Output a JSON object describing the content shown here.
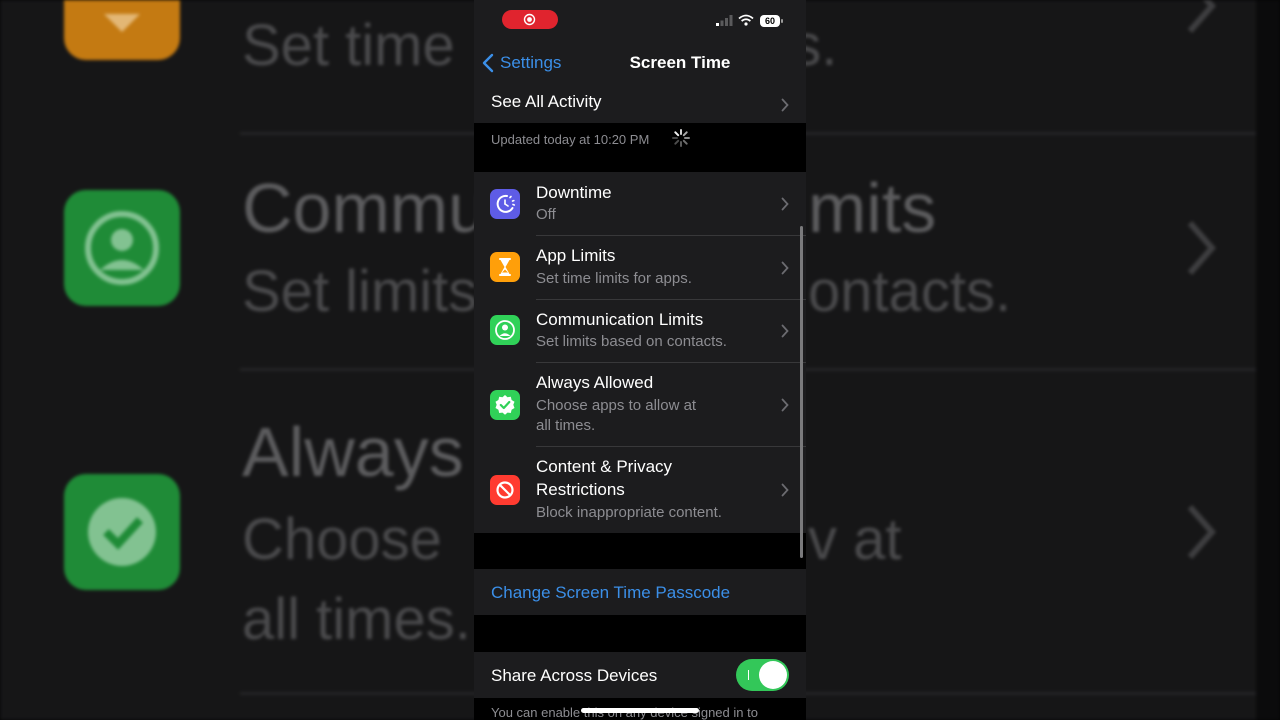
{
  "status_bar": {
    "battery": "60",
    "icons": [
      "screen-record-icon",
      "signal-icon",
      "wifi-icon",
      "battery-icon"
    ]
  },
  "nav": {
    "back_label": "Settings",
    "title": "Screen Time"
  },
  "activity": {
    "label": "See All Activity",
    "updated": "Updated today at 10:20 PM"
  },
  "menu": {
    "items": [
      {
        "title": "Downtime",
        "subtitle": "Off",
        "icon": "downtime-icon",
        "color": "#5e5ce6"
      },
      {
        "title": "App Limits",
        "subtitle": "Set time limits for apps.",
        "icon": "hourglass-icon",
        "color": "#ff9f0a"
      },
      {
        "title": "Communication Limits",
        "subtitle": "Set limits based on contacts.",
        "icon": "contact-icon",
        "color": "#30d158"
      },
      {
        "title": "Always Allowed",
        "subtitle_line1": "Choose apps to allow at",
        "subtitle_line2": "all times.",
        "icon": "checkmark-badge-icon",
        "color": "#30d158"
      },
      {
        "title_line1": "Content & Privacy",
        "title_line2": "Restrictions",
        "subtitle": "Block inappropriate content.",
        "icon": "restriction-icon",
        "color": "#ff3b30"
      }
    ]
  },
  "passcode": {
    "label": "Change Screen Time Passcode"
  },
  "share": {
    "label": "Share Across Devices",
    "enabled": true,
    "footer": "You can enable this on any device signed in to"
  },
  "background": {
    "title_1": "Set time",
    "title_1_tail": "ps.",
    "title_2": "Commu",
    "title_2_tail": "mits",
    "sub_2": "Set limits",
    "sub_2_tail": "ontacts.",
    "title_3": "Always",
    "sub_3": "Choose",
    "sub_3_tail": "v at",
    "sub_3_line2": "all times."
  },
  "colors": {
    "accent": "#3b8fe8",
    "toggle_on": "#33c759",
    "record": "#e0242e"
  }
}
